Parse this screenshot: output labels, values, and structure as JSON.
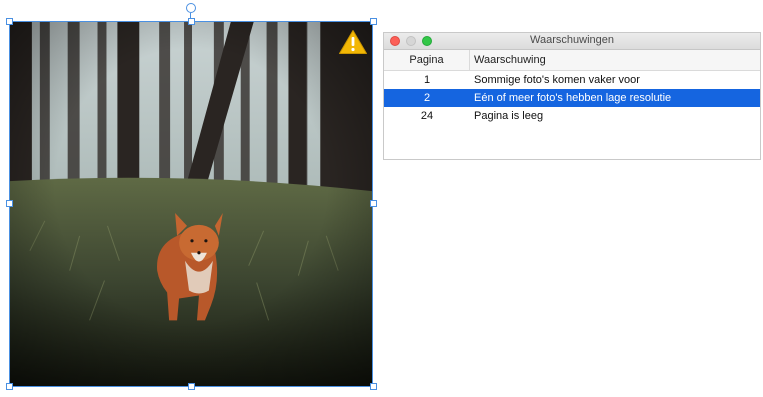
{
  "photo": {
    "alt_subject": "fox-in-forest",
    "warning_icon": "warning-icon"
  },
  "window": {
    "title": "Waarschuwingen",
    "columns": {
      "page": "Pagina",
      "warning": "Waarschuwing"
    },
    "rows": [
      {
        "page": "1",
        "warning": "Sommige foto's komen vaker voor",
        "selected": false
      },
      {
        "page": "2",
        "warning": "Eén of meer foto's hebben lage resolutie",
        "selected": true
      },
      {
        "page": "24",
        "warning": "Pagina is leeg",
        "selected": false
      }
    ]
  },
  "colors": {
    "selection": "#1565e0",
    "handle_border": "#4a90e2",
    "warning_yellow": "#f2b705"
  }
}
